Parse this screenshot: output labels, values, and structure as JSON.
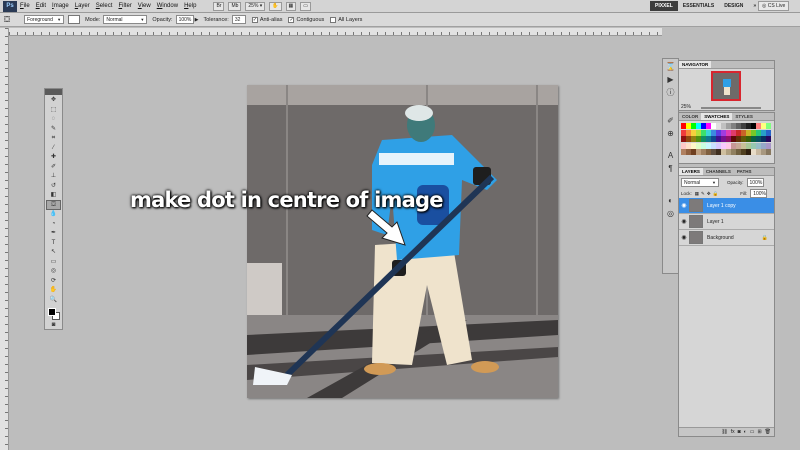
{
  "app": {
    "logo": "Ps",
    "menu": [
      "File",
      "Edit",
      "Image",
      "Layer",
      "Select",
      "Filter",
      "View",
      "Window",
      "Help"
    ],
    "zoom": "25%",
    "workspaces": [
      "PIXXEL",
      "ESSENTIALS",
      "DESIGN"
    ],
    "workspace_more": "»",
    "cs_live": "CS Live"
  },
  "options": {
    "fill_source": "Foreground",
    "mode_label": "Mode:",
    "mode_value": "Normal",
    "opacity_label": "Opacity:",
    "opacity_value": "100%",
    "tolerance_label": "Tolerance:",
    "tolerance_value": "32",
    "anti_alias": "Anti-alias",
    "contiguous": "Contiguous",
    "all_layers": "All Layers"
  },
  "canvas": {
    "caption": "make dot in centre of image"
  },
  "navigator": {
    "tab": "NAVIGATOR",
    "zoom": "25%"
  },
  "swatches": {
    "tabs": [
      "COLOR",
      "SWATCHES",
      "STYLES"
    ],
    "colors": [
      "#ff0000",
      "#ffff00",
      "#00ff00",
      "#00ffff",
      "#0000ff",
      "#ff00ff",
      "#ffffff",
      "#e0e0e0",
      "#c0c0c0",
      "#a0a0a0",
      "#808080",
      "#606060",
      "#404040",
      "#202020",
      "#000000",
      "#ff8080",
      "#ffff80",
      "#80ff80",
      "#f03c3c",
      "#f58a3c",
      "#f5d03c",
      "#b3e03c",
      "#3ce06a",
      "#3cd6d6",
      "#3c8ae0",
      "#5a3ce0",
      "#a03ce0",
      "#e03cb3",
      "#e03c6a",
      "#c82828",
      "#c86428",
      "#c8b428",
      "#78c828",
      "#28c878",
      "#28a0c8",
      "#2864c8",
      "#901010",
      "#904810",
      "#908010",
      "#509010",
      "#109060",
      "#107890",
      "#104890",
      "#401090",
      "#781090",
      "#901068",
      "#600808",
      "#603008",
      "#605808",
      "#386008",
      "#086040",
      "#085060",
      "#083060",
      "#280860",
      "#ffc8c8",
      "#ffe0c8",
      "#fff8c8",
      "#e0ffc8",
      "#c8ffe0",
      "#c8f8ff",
      "#c8e0ff",
      "#d8c8ff",
      "#f8c8ff",
      "#ffc8e8",
      "#c89696",
      "#c8a896",
      "#c8c096",
      "#a8c896",
      "#96c8b0",
      "#96bcc8",
      "#96a8c8",
      "#a896c8",
      "#b08060",
      "#906040",
      "#704020",
      "#c0a080",
      "#a08060",
      "#806040",
      "#605040",
      "#403020",
      "#d0c0a0",
      "#b0a080",
      "#908060",
      "#706040",
      "#504020",
      "#302010",
      "#e8dcc8",
      "#c8b8a0",
      "#a89880",
      "#887860"
    ]
  },
  "layers": {
    "tabs": [
      "LAYERS",
      "CHANNELS",
      "PATHS"
    ],
    "blend_mode": "Normal",
    "opacity_label": "Opacity:",
    "opacity_value": "100%",
    "lock_label": "Lock:",
    "fill_label": "Fill:",
    "fill_value": "100%",
    "items": [
      {
        "name": "Layer 1 copy"
      },
      {
        "name": "Layer 1"
      },
      {
        "name": "Background"
      }
    ]
  }
}
